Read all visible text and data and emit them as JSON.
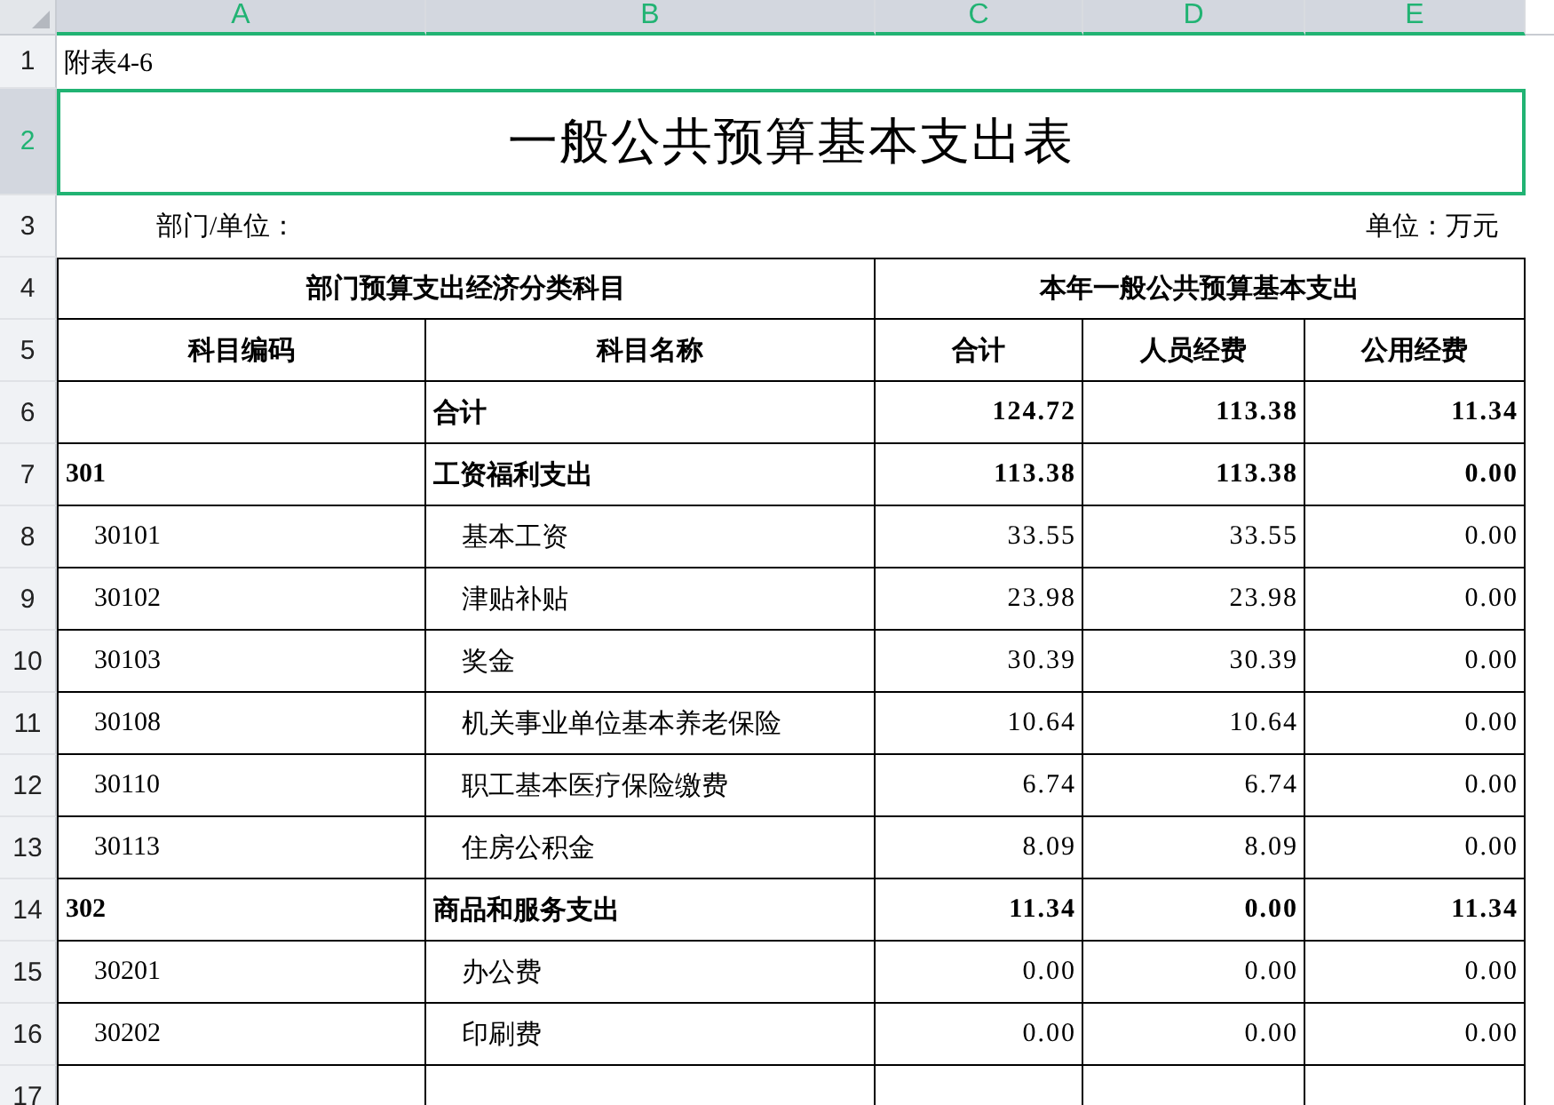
{
  "columns": [
    {
      "label": "A",
      "selected": true
    },
    {
      "label": "B",
      "selected": true
    },
    {
      "label": "C",
      "selected": true
    },
    {
      "label": "D",
      "selected": true
    },
    {
      "label": "E",
      "selected": true
    }
  ],
  "row_numbers": [
    {
      "label": "1",
      "selected": false
    },
    {
      "label": "2",
      "selected": true
    },
    {
      "label": "3",
      "selected": false
    },
    {
      "label": "4",
      "selected": false
    },
    {
      "label": "5",
      "selected": false
    },
    {
      "label": "6",
      "selected": false
    },
    {
      "label": "7",
      "selected": false
    },
    {
      "label": "8",
      "selected": false
    },
    {
      "label": "9",
      "selected": false
    },
    {
      "label": "10",
      "selected": false
    },
    {
      "label": "11",
      "selected": false
    },
    {
      "label": "12",
      "selected": false
    },
    {
      "label": "13",
      "selected": false
    },
    {
      "label": "14",
      "selected": false
    },
    {
      "label": "15",
      "selected": false
    },
    {
      "label": "16",
      "selected": false
    },
    {
      "label": "17",
      "selected": false
    }
  ],
  "note": "附表4-6",
  "title": "一般公共预算基本支出表",
  "department_label": "部门/单位：",
  "unit_label": "单位：万元",
  "header": {
    "group_left": "部门预算支出经济分类科目",
    "group_right": "本年一般公共预算基本支出",
    "columns": [
      "科目编码",
      "科目名称",
      "合计",
      "人员经费",
      "公用经费"
    ]
  },
  "data_rows": [
    {
      "kind": "total",
      "name": "合计",
      "total": "124.72",
      "personnel": "113.38",
      "public": "11.34"
    },
    {
      "kind": "category",
      "code": "301",
      "name": "工资福利支出",
      "total": "113.38",
      "personnel": "113.38",
      "public": "0.00"
    },
    {
      "kind": "item",
      "code": "30101",
      "name": "基本工资",
      "total": "33.55",
      "personnel": "33.55",
      "public": "0.00"
    },
    {
      "kind": "item",
      "code": "30102",
      "name": "津贴补贴",
      "total": "23.98",
      "personnel": "23.98",
      "public": "0.00"
    },
    {
      "kind": "item",
      "code": "30103",
      "name": "奖金",
      "total": "30.39",
      "personnel": "30.39",
      "public": "0.00"
    },
    {
      "kind": "item",
      "code": "30108",
      "name": "机关事业单位基本养老保险",
      "total": "10.64",
      "personnel": "10.64",
      "public": "0.00"
    },
    {
      "kind": "item",
      "code": "30110",
      "name": "职工基本医疗保险缴费",
      "total": "6.74",
      "personnel": "6.74",
      "public": "0.00"
    },
    {
      "kind": "item",
      "code": "30113",
      "name": "住房公积金",
      "total": "8.09",
      "personnel": "8.09",
      "public": "0.00"
    },
    {
      "kind": "category",
      "code": "302",
      "name": "商品和服务支出",
      "total": "11.34",
      "personnel": "0.00",
      "public": "11.34"
    },
    {
      "kind": "item",
      "code": "30201",
      "name": "办公费",
      "total": "0.00",
      "personnel": "0.00",
      "public": "0.00"
    },
    {
      "kind": "item",
      "code": "30202",
      "name": "印刷费",
      "total": "0.00",
      "personnel": "0.00",
      "public": "0.00"
    }
  ]
}
